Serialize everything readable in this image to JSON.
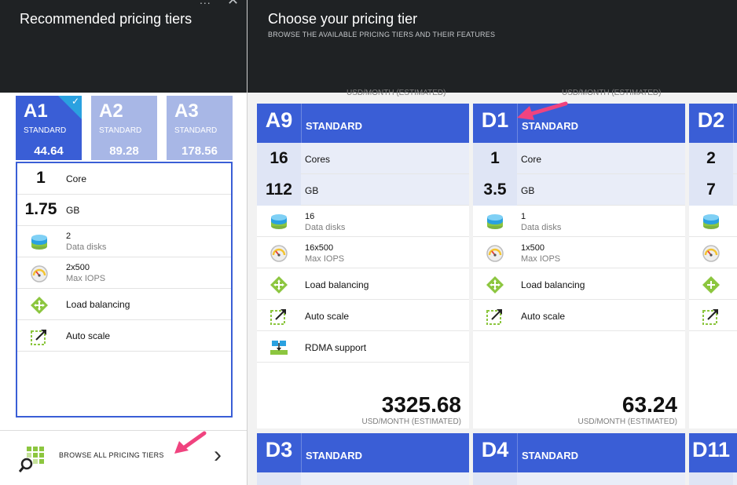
{
  "left": {
    "title": "Recommended pricing tiers",
    "menu_glyph": "...",
    "close_glyph": "✕",
    "tiers": [
      {
        "code": "A1",
        "label": "STANDARD",
        "price": "44.64",
        "selected": true
      },
      {
        "code": "A2",
        "label": "STANDARD",
        "price": "89.28",
        "selected": false
      },
      {
        "code": "A3",
        "label": "STANDARD",
        "price": "178.56",
        "selected": false
      }
    ],
    "check_glyph": "✓",
    "features": {
      "cores_value": "1",
      "cores_label": "Core",
      "ram_value": "1.75",
      "ram_label": "GB",
      "disks_value": "2",
      "disks_label": "Data disks",
      "iops_value": "2x500",
      "iops_label": "Max IOPS",
      "lb_label": "Load balancing",
      "autoscale_label": "Auto scale"
    },
    "browse_label": "BROWSE ALL PRICING TIERS",
    "browse_chevron": "›"
  },
  "right": {
    "title": "Choose your pricing tier",
    "subtitle": "BROWSE THE AVAILABLE PRICING TIERS AND THEIR FEATURES",
    "usd_label": "USD/MONTH (ESTIMATED)",
    "cards": {
      "a9": {
        "code": "A9",
        "label": "STANDARD",
        "cores_value": "16",
        "cores_label": "Cores",
        "ram_value": "112",
        "ram_label": "GB",
        "disks_value": "16",
        "disks_label": "Data disks",
        "iops_value": "16x500",
        "iops_label": "Max IOPS",
        "lb_label": "Load balancing",
        "autoscale_label": "Auto scale",
        "rdma_label": "RDMA support",
        "price": "3325.68"
      },
      "d1": {
        "code": "D1",
        "label": "STANDARD",
        "cores_value": "1",
        "cores_label": "Core",
        "ram_value": "3.5",
        "ram_label": "GB",
        "disks_value": "1",
        "disks_label": "Data disks",
        "iops_value": "1x500",
        "iops_label": "Max IOPS",
        "lb_label": "Load balancing",
        "autoscale_label": "Auto scale",
        "price": "63.24"
      },
      "d2": {
        "code": "D2",
        "cores_value": "2",
        "ram_value": "7"
      },
      "d3": {
        "code": "D3",
        "label": "STANDARD"
      },
      "d4": {
        "code": "D4",
        "label": "STANDARD"
      },
      "d11": {
        "code": "D11"
      }
    }
  },
  "colors": {
    "header_bg": "#1f2224",
    "tier_blue": "#3a5ed6",
    "tier_light": "#a8b7e6",
    "check_corner": "#2aa1e0",
    "annotation_pink": "#f0437f",
    "icon_green": "#8cc63f"
  },
  "icons": [
    "disk-icon",
    "gauge-icon",
    "load-balancing-icon",
    "auto-scale-icon",
    "rdma-icon",
    "browse-grid-magnifier-icon"
  ]
}
